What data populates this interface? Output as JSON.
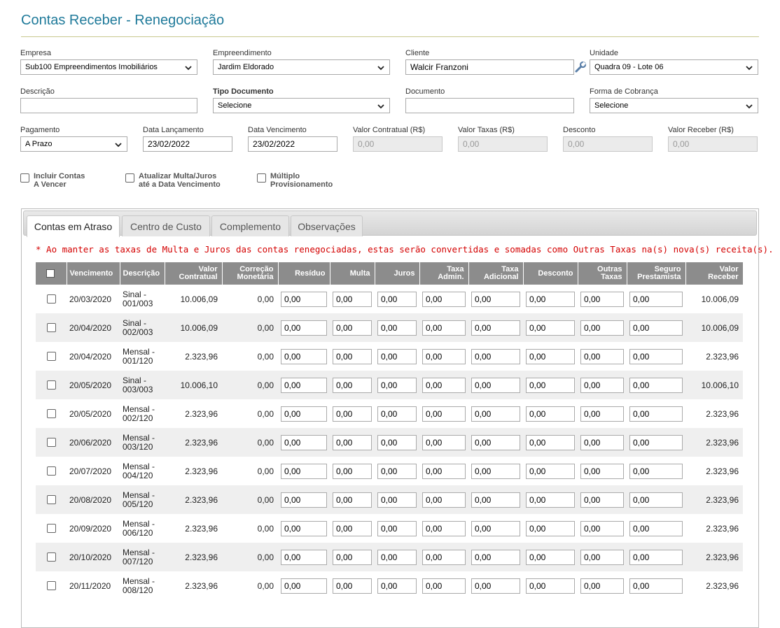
{
  "page": {
    "title": "Contas Receber - Renegociação"
  },
  "form": {
    "empresa": {
      "label": "Empresa",
      "value": "Sub100 Empreendimentos Imobiliários"
    },
    "empreendimento": {
      "label": "Empreendimento",
      "value": "Jardim Eldorado"
    },
    "cliente": {
      "label": "Cliente",
      "value": "Walcir Franzoni"
    },
    "unidade": {
      "label": "Unidade",
      "value": "Quadra 09 - Lote 06"
    },
    "descricao": {
      "label": "Descrição",
      "value": ""
    },
    "tipo_documento": {
      "label": "Tipo Documento",
      "value": "Selecione"
    },
    "documento": {
      "label": "Documento",
      "value": ""
    },
    "forma_cobranca": {
      "label": "Forma de Cobrança",
      "value": "Selecione"
    },
    "pagamento": {
      "label": "Pagamento",
      "value": "A Prazo"
    },
    "data_lancamento": {
      "label": "Data Lançamento",
      "value": "23/02/2022"
    },
    "data_vencimento": {
      "label": "Data Vencimento",
      "value": "23/02/2022"
    },
    "valor_contratual": {
      "label": "Valor Contratual (R$)",
      "value": "0,00"
    },
    "valor_taxas": {
      "label": "Valor Taxas (R$)",
      "value": "0,00"
    },
    "desconto": {
      "label": "Desconto",
      "value": "0,00"
    },
    "valor_receber": {
      "label": "Valor Receber (R$)",
      "value": "0,00"
    }
  },
  "checkboxes": {
    "incluir": "Incluir Contas\nA Vencer",
    "atualizar": "Atualizar Multa/Juros\naté a Data Vencimento",
    "multiplo": "Múltiplo\nProvisionamento"
  },
  "tabs": [
    "Contas em Atraso",
    "Centro de Custo",
    "Complemento",
    "Observações"
  ],
  "warning": "* Ao manter as taxas de Multa e Juros das contas renegociadas, estas serão convertidas e somadas como Outras Taxas na(s) nova(s) receita(s).",
  "table": {
    "headers": {
      "vencimento": "Vencimento",
      "descricao": "Descrição",
      "valor_contratual": "Valor\nContratual",
      "correcao": "Correção\nMonetária",
      "residuo": "Resíduo",
      "multa": "Multa",
      "juros": "Juros",
      "taxa_admin": "Taxa\nAdmin.",
      "taxa_adicional": "Taxa\nAdicional",
      "desconto": "Desconto",
      "outras_taxas": "Outras\nTaxas",
      "seguro": "Seguro\nPrestamista",
      "valor_receber": "Valor\nReceber"
    },
    "rows": [
      {
        "vencimento": "20/03/2020",
        "descricao": "Sinal -\n001/003",
        "valor_contratual": "10.006,09",
        "correcao": "0,00",
        "residuo": "0,00",
        "multa": "0,00",
        "juros": "0,00",
        "taxa_admin": "0,00",
        "taxa_adicional": "0,00",
        "desconto": "0,00",
        "outras_taxas": "0,00",
        "seguro": "0,00",
        "valor_receber": "10.006,09"
      },
      {
        "vencimento": "20/04/2020",
        "descricao": "Sinal -\n002/003",
        "valor_contratual": "10.006,09",
        "correcao": "0,00",
        "residuo": "0,00",
        "multa": "0,00",
        "juros": "0,00",
        "taxa_admin": "0,00",
        "taxa_adicional": "0,00",
        "desconto": "0,00",
        "outras_taxas": "0,00",
        "seguro": "0,00",
        "valor_receber": "10.006,09"
      },
      {
        "vencimento": "20/04/2020",
        "descricao": "Mensal -\n001/120",
        "valor_contratual": "2.323,96",
        "correcao": "0,00",
        "residuo": "0,00",
        "multa": "0,00",
        "juros": "0,00",
        "taxa_admin": "0,00",
        "taxa_adicional": "0,00",
        "desconto": "0,00",
        "outras_taxas": "0,00",
        "seguro": "0,00",
        "valor_receber": "2.323,96"
      },
      {
        "vencimento": "20/05/2020",
        "descricao": "Sinal -\n003/003",
        "valor_contratual": "10.006,10",
        "correcao": "0,00",
        "residuo": "0,00",
        "multa": "0,00",
        "juros": "0,00",
        "taxa_admin": "0,00",
        "taxa_adicional": "0,00",
        "desconto": "0,00",
        "outras_taxas": "0,00",
        "seguro": "0,00",
        "valor_receber": "10.006,10"
      },
      {
        "vencimento": "20/05/2020",
        "descricao": "Mensal -\n002/120",
        "valor_contratual": "2.323,96",
        "correcao": "0,00",
        "residuo": "0,00",
        "multa": "0,00",
        "juros": "0,00",
        "taxa_admin": "0,00",
        "taxa_adicional": "0,00",
        "desconto": "0,00",
        "outras_taxas": "0,00",
        "seguro": "0,00",
        "valor_receber": "2.323,96"
      },
      {
        "vencimento": "20/06/2020",
        "descricao": "Mensal -\n003/120",
        "valor_contratual": "2.323,96",
        "correcao": "0,00",
        "residuo": "0,00",
        "multa": "0,00",
        "juros": "0,00",
        "taxa_admin": "0,00",
        "taxa_adicional": "0,00",
        "desconto": "0,00",
        "outras_taxas": "0,00",
        "seguro": "0,00",
        "valor_receber": "2.323,96"
      },
      {
        "vencimento": "20/07/2020",
        "descricao": "Mensal -\n004/120",
        "valor_contratual": "2.323,96",
        "correcao": "0,00",
        "residuo": "0,00",
        "multa": "0,00",
        "juros": "0,00",
        "taxa_admin": "0,00",
        "taxa_adicional": "0,00",
        "desconto": "0,00",
        "outras_taxas": "0,00",
        "seguro": "0,00",
        "valor_receber": "2.323,96"
      },
      {
        "vencimento": "20/08/2020",
        "descricao": "Mensal -\n005/120",
        "valor_contratual": "2.323,96",
        "correcao": "0,00",
        "residuo": "0,00",
        "multa": "0,00",
        "juros": "0,00",
        "taxa_admin": "0,00",
        "taxa_adicional": "0,00",
        "desconto": "0,00",
        "outras_taxas": "0,00",
        "seguro": "0,00",
        "valor_receber": "2.323,96"
      },
      {
        "vencimento": "20/09/2020",
        "descricao": "Mensal -\n006/120",
        "valor_contratual": "2.323,96",
        "correcao": "0,00",
        "residuo": "0,00",
        "multa": "0,00",
        "juros": "0,00",
        "taxa_admin": "0,00",
        "taxa_adicional": "0,00",
        "desconto": "0,00",
        "outras_taxas": "0,00",
        "seguro": "0,00",
        "valor_receber": "2.323,96"
      },
      {
        "vencimento": "20/10/2020",
        "descricao": "Mensal -\n007/120",
        "valor_contratual": "2.323,96",
        "correcao": "0,00",
        "residuo": "0,00",
        "multa": "0,00",
        "juros": "0,00",
        "taxa_admin": "0,00",
        "taxa_adicional": "0,00",
        "desconto": "0,00",
        "outras_taxas": "0,00",
        "seguro": "0,00",
        "valor_receber": "2.323,96"
      },
      {
        "vencimento": "20/11/2020",
        "descricao": "Mensal -\n008/120",
        "valor_contratual": "2.323,96",
        "correcao": "0,00",
        "residuo": "0,00",
        "multa": "0,00",
        "juros": "0,00",
        "taxa_admin": "0,00",
        "taxa_adicional": "0,00",
        "desconto": "0,00",
        "outras_taxas": "0,00",
        "seguro": "0,00",
        "valor_receber": "2.323,96"
      }
    ]
  }
}
